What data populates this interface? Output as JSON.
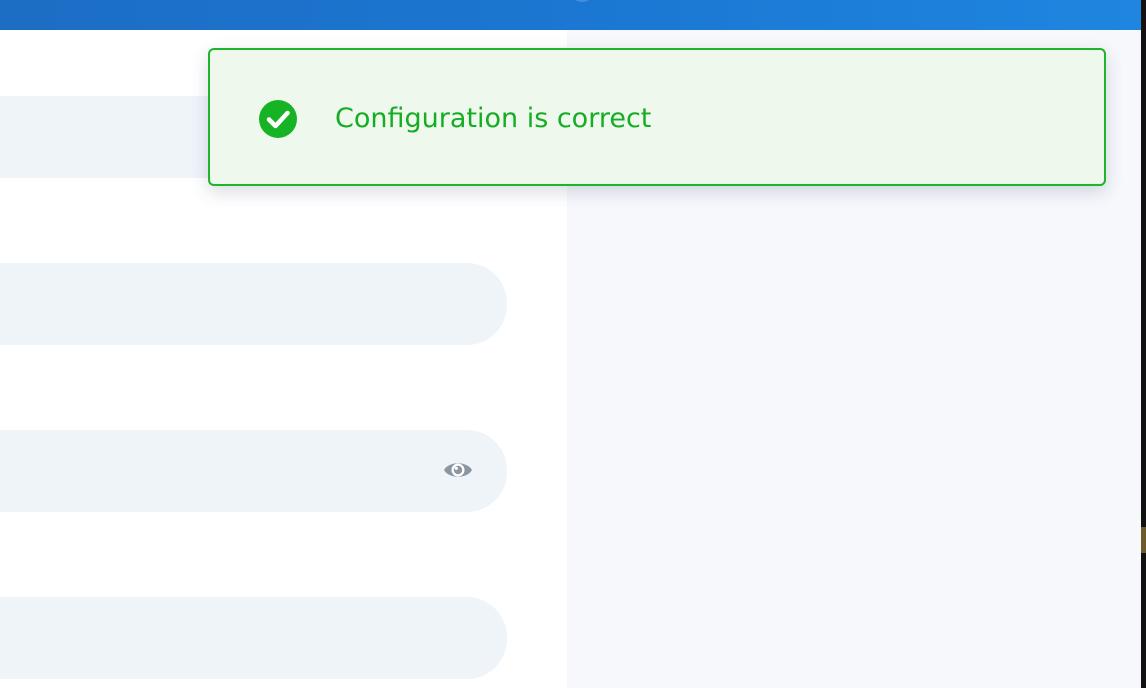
{
  "colors": {
    "header": "#1b78d3",
    "toast_background": "#eef8ec",
    "toast_border": "#1eb52a",
    "toast_text": "#16ad25",
    "field_background": "#eff4f9",
    "side_panel": "#f6f8fc",
    "icon_gray": "#8a97a3"
  },
  "toast": {
    "type": "success",
    "icon": "check-circle-icon",
    "message": "Configuration is correct"
  },
  "form": {
    "fields": [
      {
        "value": ""
      },
      {
        "value": ""
      },
      {
        "value": "",
        "toggle_icon": "eye-icon"
      },
      {
        "value": ""
      }
    ]
  }
}
